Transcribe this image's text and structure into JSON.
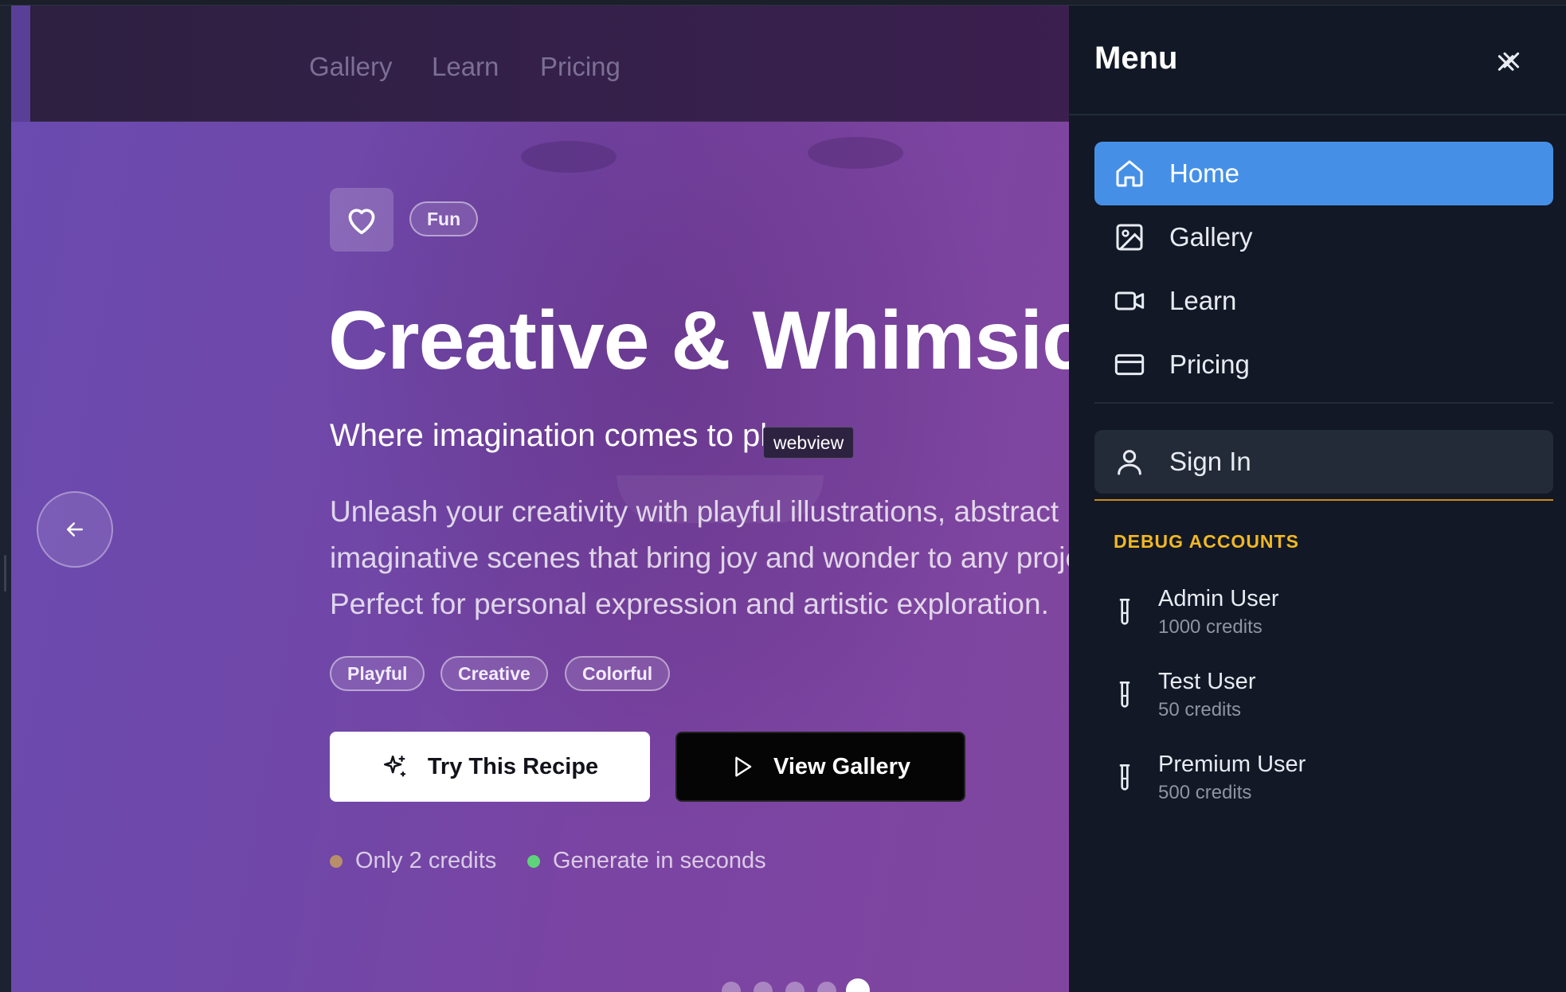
{
  "nav": {
    "links": [
      "Gallery",
      "Learn",
      "Pricing"
    ]
  },
  "hero": {
    "badge": "Fun",
    "title": "Creative & Whimsical",
    "subtitle": "Where imagination comes to play",
    "description_lines": [
      "Unleash your creativity with playful illustrations, abstract",
      "imaginative scenes that bring joy and wonder to any project.",
      "Perfect for personal expression and artistic exploration."
    ],
    "tags": [
      "Playful",
      "Creative",
      "Colorful"
    ],
    "try_button": "Try This Recipe",
    "view_button": "View Gallery",
    "meta": [
      {
        "text": "Only 2 credits",
        "color": "#b98f6a"
      },
      {
        "text": "Generate in seconds",
        "color": "#5fd37a"
      }
    ],
    "pager": {
      "count": 5,
      "active_index": 4
    }
  },
  "tooltip": "webview",
  "menu": {
    "title": "Menu",
    "items": [
      {
        "label": "Home",
        "icon": "home-icon",
        "active": true
      },
      {
        "label": "Gallery",
        "icon": "image-icon",
        "active": false
      },
      {
        "label": "Learn",
        "icon": "video-icon",
        "active": false
      },
      {
        "label": "Pricing",
        "icon": "credit-card-icon",
        "active": false
      }
    ],
    "sign_in": "Sign In",
    "debug_label": "DEBUG ACCOUNTS",
    "accounts": [
      {
        "name": "Admin User",
        "credits": "1000 credits"
      },
      {
        "name": "Test User",
        "credits": "50 credits"
      },
      {
        "name": "Premium User",
        "credits": "500 credits"
      }
    ]
  },
  "colors": {
    "accent": "#4590e6",
    "debug": "#f2b824",
    "hero": "#6f48aa"
  }
}
